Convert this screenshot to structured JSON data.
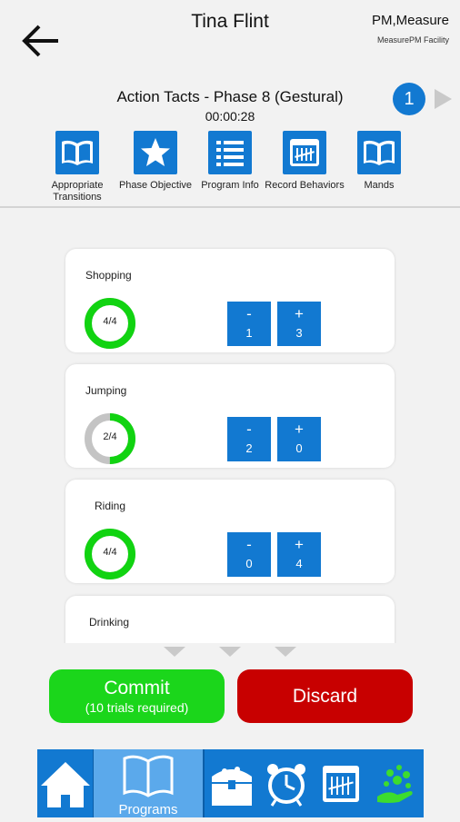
{
  "header": {
    "client_name": "Tina Flint",
    "user_name": "PM,Measure",
    "facility": "MeasurePM Facility",
    "program_title": "Action Tacts - Phase 8 (Gestural)",
    "timer": "00:00:28",
    "count_badge": "1"
  },
  "toolbar": [
    {
      "label": "Appropriate Transitions",
      "icon": "book-icon"
    },
    {
      "label": "Phase Objective",
      "icon": "star-icon"
    },
    {
      "label": "Program Info",
      "icon": "list-icon"
    },
    {
      "label": "Record Behaviors",
      "icon": "calendar-icon"
    },
    {
      "label": "Mands",
      "icon": "book-icon"
    }
  ],
  "targets": [
    {
      "name": "Shopping",
      "progress": "4/4",
      "fraction": 1.0,
      "minus_label": "-",
      "minus_count": "1",
      "plus_label": "+",
      "plus_count": "3"
    },
    {
      "name": "Jumping",
      "progress": "2/4",
      "fraction": 0.5,
      "minus_label": "-",
      "minus_count": "2",
      "plus_label": "+",
      "plus_count": "0"
    },
    {
      "name": "Riding",
      "progress": "4/4",
      "fraction": 1.0,
      "minus_label": "-",
      "minus_count": "0",
      "plus_label": "+",
      "plus_count": "4"
    },
    {
      "name": "Drinking"
    }
  ],
  "actions": {
    "commit_label": "Commit",
    "commit_sublabel": "(10 trials required)",
    "discard_label": "Discard"
  },
  "bottom_nav": {
    "items": [
      "home-icon",
      "programs-icon",
      "treasure-chest-icon",
      "alarm-clock-icon",
      "calendar-icon",
      "reinforcement-icon"
    ],
    "programs_label": "Programs"
  },
  "colors": {
    "accent_blue": "#1279d1",
    "nav_selected": "#5ba9eb",
    "commit_green": "#1bd61b",
    "discard_red": "#c80000",
    "ring_complete": "#11d311",
    "ring_incomplete": "#c4c4c4"
  }
}
